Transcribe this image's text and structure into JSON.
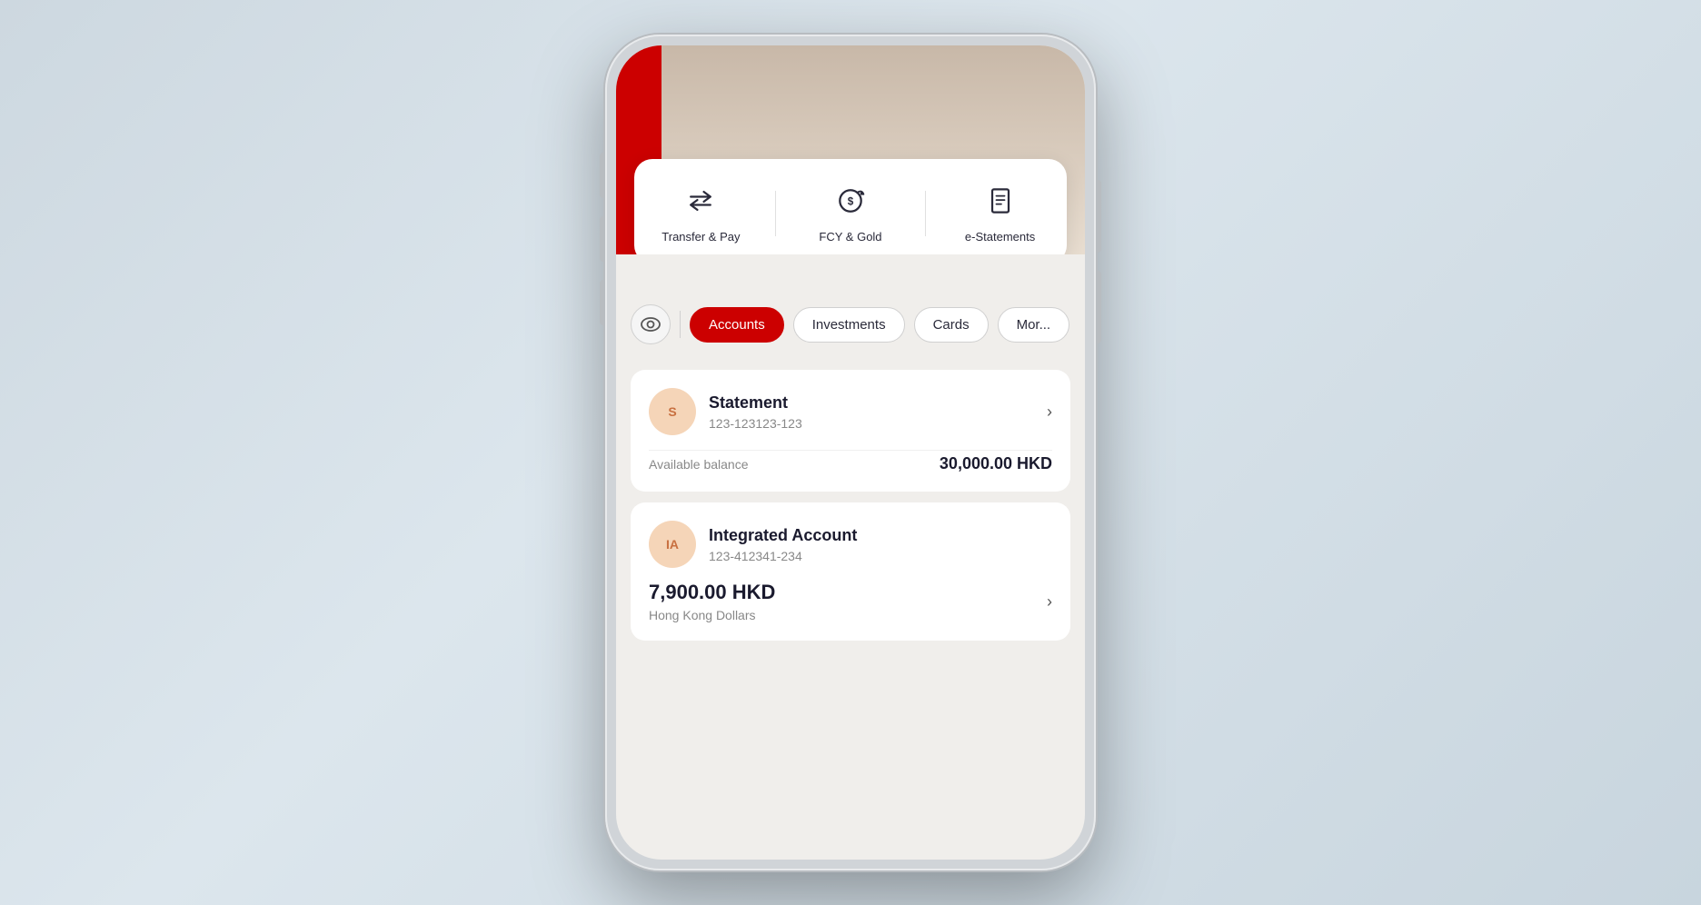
{
  "background": {
    "color": "#cdd8e0"
  },
  "quick_actions": {
    "items": [
      {
        "id": "transfer-pay",
        "label": "Transfer & Pay",
        "icon": "transfer-icon"
      },
      {
        "id": "fcy-gold",
        "label": "FCY & Gold",
        "icon": "fcy-icon"
      },
      {
        "id": "e-statements",
        "label": "e-Statements",
        "icon": "estatements-icon"
      }
    ]
  },
  "tabs": {
    "eye_label": "eye",
    "items": [
      {
        "id": "accounts",
        "label": "Accounts",
        "active": true
      },
      {
        "id": "investments",
        "label": "Investments",
        "active": false
      },
      {
        "id": "cards",
        "label": "Cards",
        "active": false
      },
      {
        "id": "more",
        "label": "Mor...",
        "active": false
      }
    ]
  },
  "accounts": [
    {
      "id": "statement",
      "avatar_text": "S",
      "name": "Statement",
      "number": "123-123123-123",
      "balance_label": "Available balance",
      "balance_amount": "30,000.00 HKD"
    },
    {
      "id": "integrated",
      "avatar_text": "IA",
      "name": "Integrated Account",
      "number": "123-412341-234",
      "amount_main": "7,900.00 HKD",
      "amount_sub": "Hong Kong Dollars"
    }
  ]
}
